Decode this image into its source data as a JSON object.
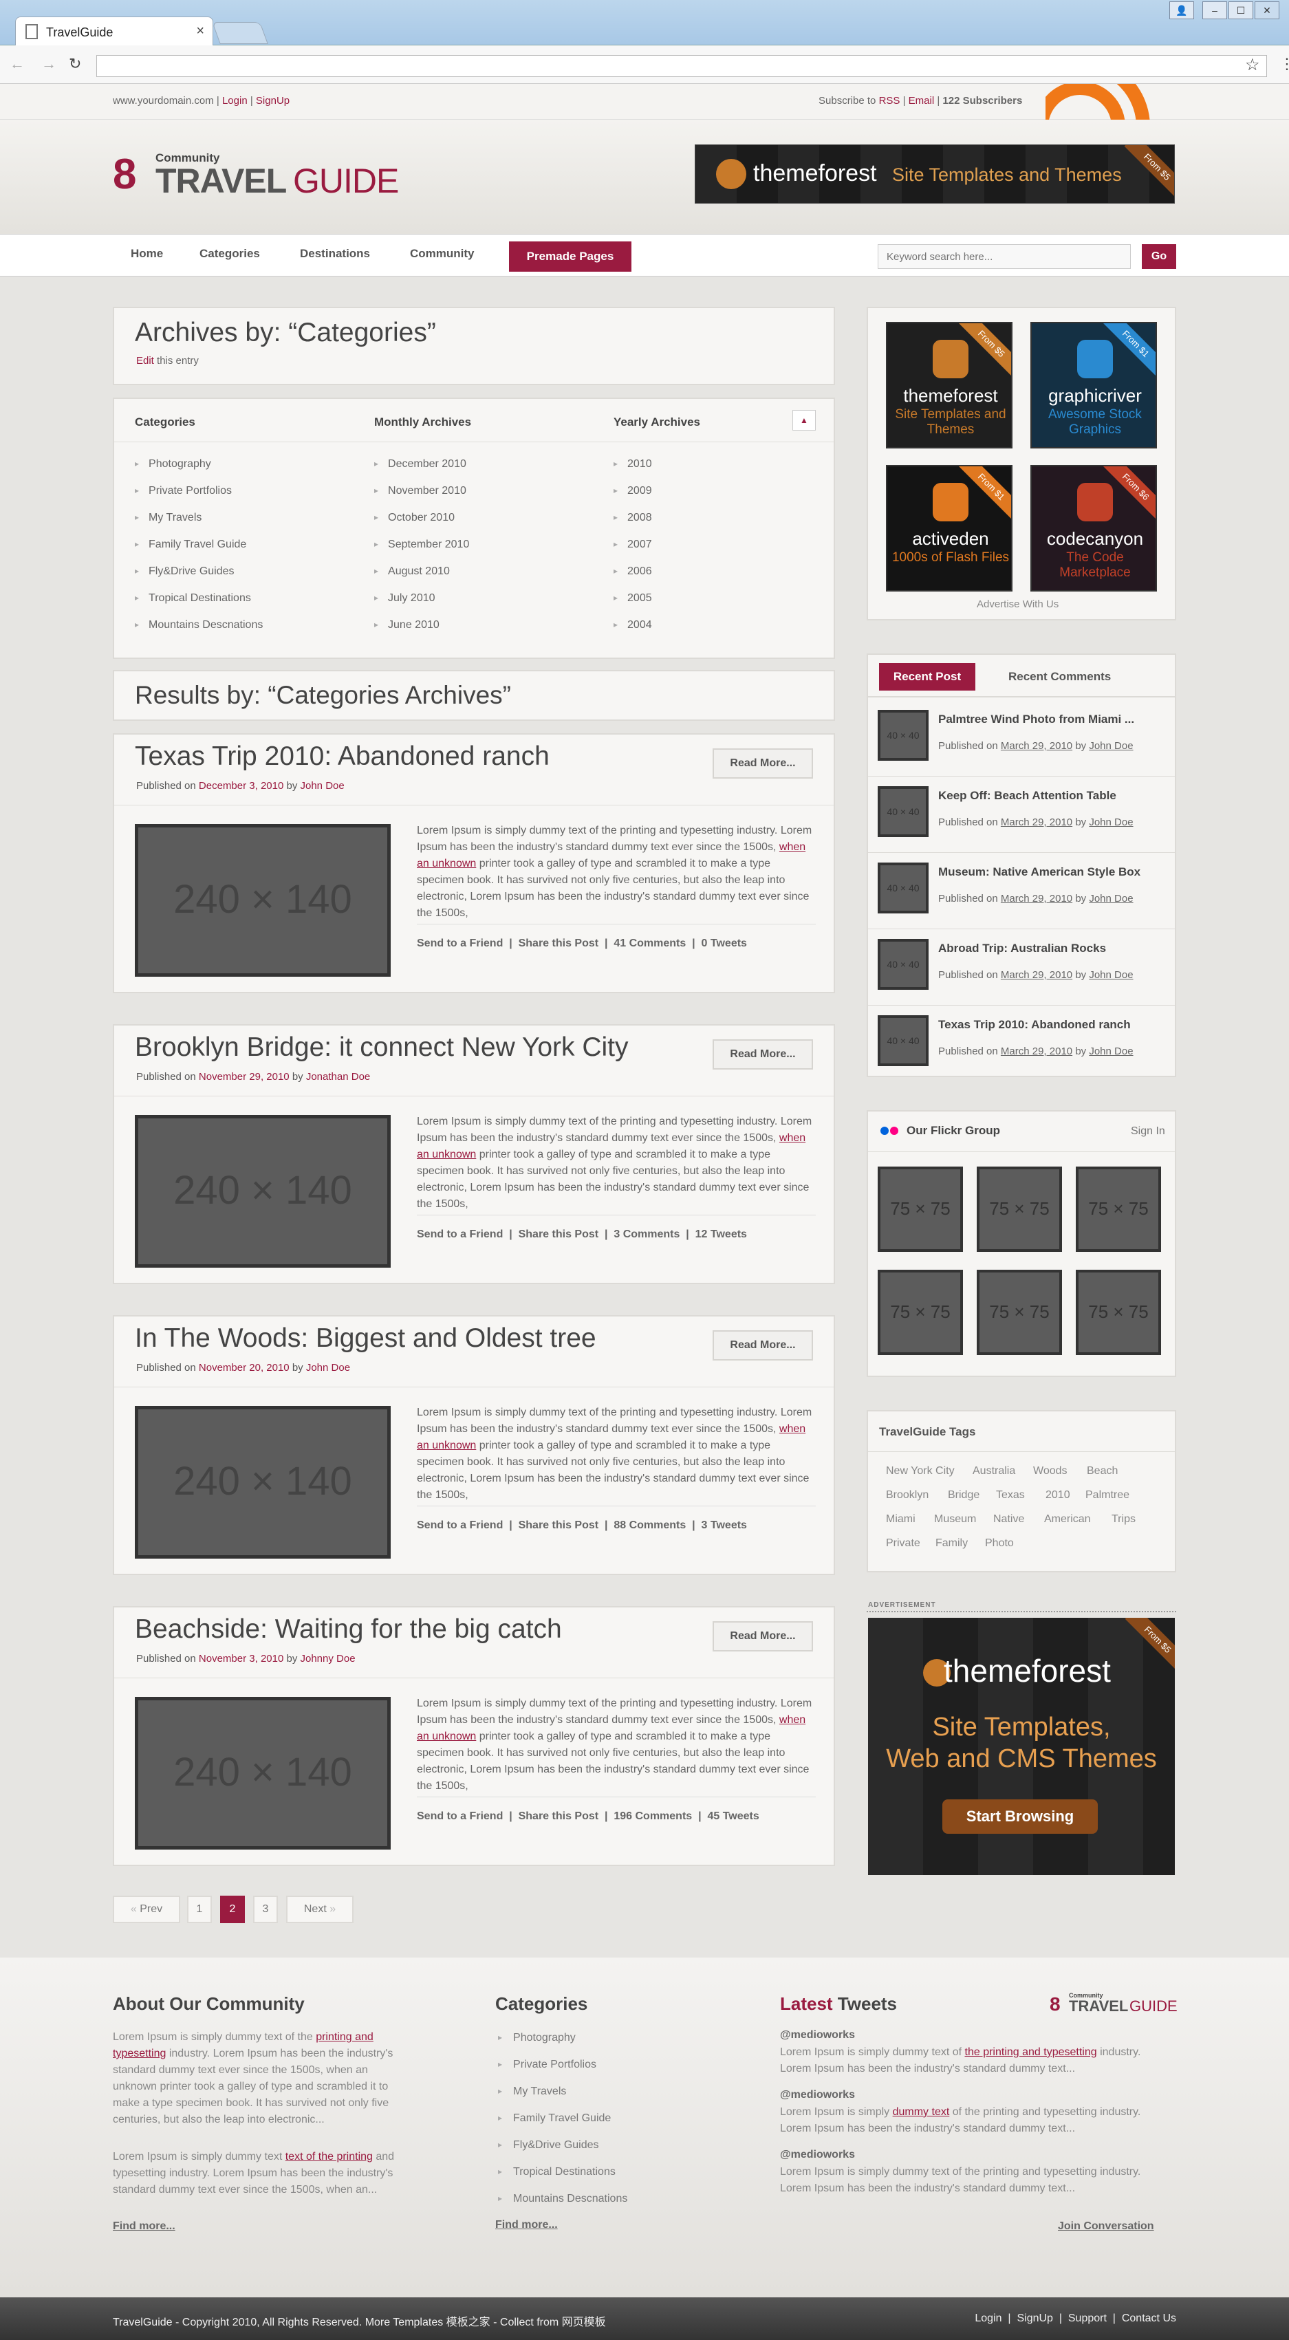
{
  "browser": {
    "tab_title": "TravelGuide",
    "close": "×",
    "back": "←",
    "forward": "→",
    "reload": "↻",
    "star": "☆",
    "menu": "⋮",
    "win_min": "–",
    "win_max": "☐",
    "win_close": "✕",
    "win_user": "👤"
  },
  "topbar": {
    "domain": "www.yourdomain.com",
    "sep": "|",
    "login": "Login",
    "signup": "SignUp",
    "subscribe": "Subscribe to",
    "rss": "RSS",
    "email": "Email",
    "subscribers": "122 Subscribers"
  },
  "logo": {
    "mark": "8",
    "community": "Community",
    "travel": "TRAVEL",
    "guide": "GUIDE"
  },
  "header_ad": {
    "brand": "themeforest",
    "tagline": "Site Templates and Themes",
    "ribbon": "From $5"
  },
  "nav": {
    "items": [
      "Home",
      "Categories",
      "Destinations",
      "Community"
    ],
    "premade": "Premade Pages",
    "search_placeholder": "Keyword search here...",
    "go": "Go"
  },
  "archives": {
    "title": "Archives by: “Categories”",
    "edit": "Edit",
    "edit_suffix": "this entry",
    "col1_title": "Categories",
    "col1": [
      "Photography",
      "Private Portfolios",
      "My Travels",
      "Family Travel Guide",
      "Fly&Drive Guides",
      "Tropical Destinations",
      "Mountains Descnations"
    ],
    "col2_title": "Monthly Archives",
    "col2": [
      "December 2010",
      "November 2010",
      "October 2010",
      "September 2010",
      "August 2010",
      "July 2010",
      "June 2010"
    ],
    "col3_title": "Yearly Archives",
    "col3": [
      "2010",
      "2009",
      "2008",
      "2007",
      "2006",
      "2005",
      "2004"
    ],
    "collapse": "▲"
  },
  "results_title": "Results by: “Categories Archives”",
  "posts": [
    {
      "title": "Texas Trip 2010: Abandoned ranch",
      "published": "Published on",
      "date": "December 3, 2010",
      "by": "by",
      "author": "John Doe",
      "read_more": "Read More...",
      "thumb": "240 × 140",
      "comments": "41 Comments",
      "tweets": "0 Tweets"
    },
    {
      "title": "Brooklyn Bridge: it connect New York City",
      "published": "Published on",
      "date": "November 29, 2010",
      "by": "by",
      "author": "Jonathan Doe",
      "read_more": "Read More...",
      "thumb": "240 × 140",
      "comments": "3 Comments",
      "tweets": "12 Tweets"
    },
    {
      "title": "In The Woods: Biggest and Oldest tree",
      "published": "Published on",
      "date": "November 20, 2010",
      "by": "by",
      "author": "John Doe",
      "read_more": "Read More...",
      "thumb": "240 × 140",
      "comments": "88 Comments",
      "tweets": "3 Tweets"
    },
    {
      "title": "Beachside: Waiting for the big catch",
      "published": "Published on",
      "date": "November 3, 2010",
      "by": "by",
      "author": "Johnny Doe",
      "read_more": "Read More...",
      "thumb": "240 × 140",
      "comments": "196 Comments",
      "tweets": "45 Tweets"
    }
  ],
  "excerpt": {
    "a": "Lorem Ipsum is simply dummy text of the printing and typesetting industry. Lorem Ipsum has been the industry's standard dummy text ever since the 1500s, ",
    "link": "when an unknown",
    "b": " printer took a galley of type and scrambled it to make a type specimen book. It has survived not only five centuries, but also the leap into electronic, Lorem Ipsum has been the industry's standard dummy text ever since the 1500s,"
  },
  "social": {
    "send": "Send to a Friend",
    "share": "Share this Post",
    "sep": "|"
  },
  "pagination": {
    "prev": "Prev",
    "pages": [
      "1",
      "2",
      "3"
    ],
    "next": "Next",
    "prev_arrow": "«",
    "next_arrow": "»"
  },
  "sidebar_ads": [
    {
      "brand": "themeforest",
      "sub": "Site Templates and Themes",
      "ribbon": "From $5",
      "bg": "#1f1f1f",
      "accent": "#c87a2a"
    },
    {
      "brand": "graphicriver",
      "sub": "Awesome Stock Graphics",
      "ribbon": "From $1",
      "bg": "#143044",
      "accent": "#2a8ad0"
    },
    {
      "brand": "activeden",
      "sub": "1000s of Flash Files",
      "ribbon": "From $1",
      "bg": "#141414",
      "accent": "#e07820"
    },
    {
      "brand": "codecanyon",
      "sub": "The Code Marketplace",
      "ribbon": "From $6",
      "bg": "#241820",
      "accent": "#c04028"
    }
  ],
  "advertise": "Advertise With Us",
  "recent": {
    "tab_active": "Recent Post",
    "tab_other": "Recent Comments",
    "thumb": "40 × 40",
    "items": [
      {
        "title": "Palmtree Wind Photo from Miami ...",
        "published": "Published on",
        "date": "March 29, 2010",
        "by": "by",
        "author": "John Doe"
      },
      {
        "title": "Keep Off: Beach Attention Table",
        "published": "Published on",
        "date": "March 29, 2010",
        "by": "by",
        "author": "John Doe"
      },
      {
        "title": "Museum: Native American Style Box",
        "published": "Published on",
        "date": "March 29, 2010",
        "by": "by",
        "author": "John Doe"
      },
      {
        "title": "Abroad Trip: Australian Rocks",
        "published": "Published on",
        "date": "March 29, 2010",
        "by": "by",
        "author": "John Doe"
      },
      {
        "title": "Texas Trip 2010: Abandoned ranch",
        "published": "Published on",
        "date": "March 29, 2010",
        "by": "by",
        "author": "John Doe"
      }
    ]
  },
  "flickr": {
    "title": "Our Flickr Group",
    "signin": "Sign In",
    "thumb": "75 × 75"
  },
  "tags": {
    "title": "TravelGuide Tags",
    "items": [
      "New York City",
      "Australia",
      "Woods",
      "Beach",
      "Brooklyn",
      "Bridge",
      "Texas",
      "2010",
      "Palmtree",
      "Miami",
      "Museum",
      "Native",
      "American",
      "Trips",
      "Private",
      "Family",
      "Photo"
    ]
  },
  "big_ad": {
    "label": "ADVERTISEMENT",
    "brand": "themeforest",
    "line1": "Site Templates,",
    "line2": "Web and CMS Themes",
    "button": "Start Browsing",
    "ribbon": "From $5"
  },
  "footer": {
    "about_title": "About Our Community",
    "about_p1a": "Lorem Ipsum is simply dummy text of the ",
    "about_p1link": "printing and typesetting",
    "about_p1b": " industry. Lorem Ipsum has been the industry's standard dummy text ever since the 1500s, when an unknown printer took a galley of type and scrambled it to make a type specimen book. It has survived not only five centuries, but also the leap into electronic...",
    "about_p2a": "Lorem Ipsum is simply dummy text ",
    "about_p2link": "text of the printing",
    "about_p2b": " and typesetting industry. Lorem Ipsum has been the industry's standard dummy text ever since the 1500s, when an...",
    "find_more": "Find more...",
    "cat_title": "Categories",
    "cats": [
      "Photography",
      "Private Portfolios",
      "My Travels",
      "Family Travel Guide",
      "Fly&Drive Guides",
      "Tropical Destinations",
      "Mountains Descnations"
    ],
    "tweets_title_a": "Latest",
    "tweets_title_b": " Tweets",
    "tweets": [
      {
        "user": "@medioworks",
        "a": "Lorem Ipsum is simply dummy text of ",
        "link": "the printing and typesetting",
        "b": " industry. Lorem Ipsum has been the industry's standard dummy text..."
      },
      {
        "user": "@medioworks",
        "a": "Lorem Ipsum is simply ",
        "link": "dummy text",
        "b": " of the printing and typesetting industry. Lorem Ipsum has been the industry's standard dummy text..."
      },
      {
        "user": "@medioworks",
        "a": "Lorem Ipsum is simply dummy text of the printing and typesetting industry. Lorem Ipsum has been the industry's standard dummy text...",
        "link": "",
        "b": ""
      }
    ],
    "join": "Join Conversation"
  },
  "bottom": {
    "left": "TravelGuide - Copyright 2010, All Rights Reserved. More Templates 模板之家 - Collect from 网页模板",
    "right": "Login  |  SignUp  |  Support  |  Contact Us"
  }
}
